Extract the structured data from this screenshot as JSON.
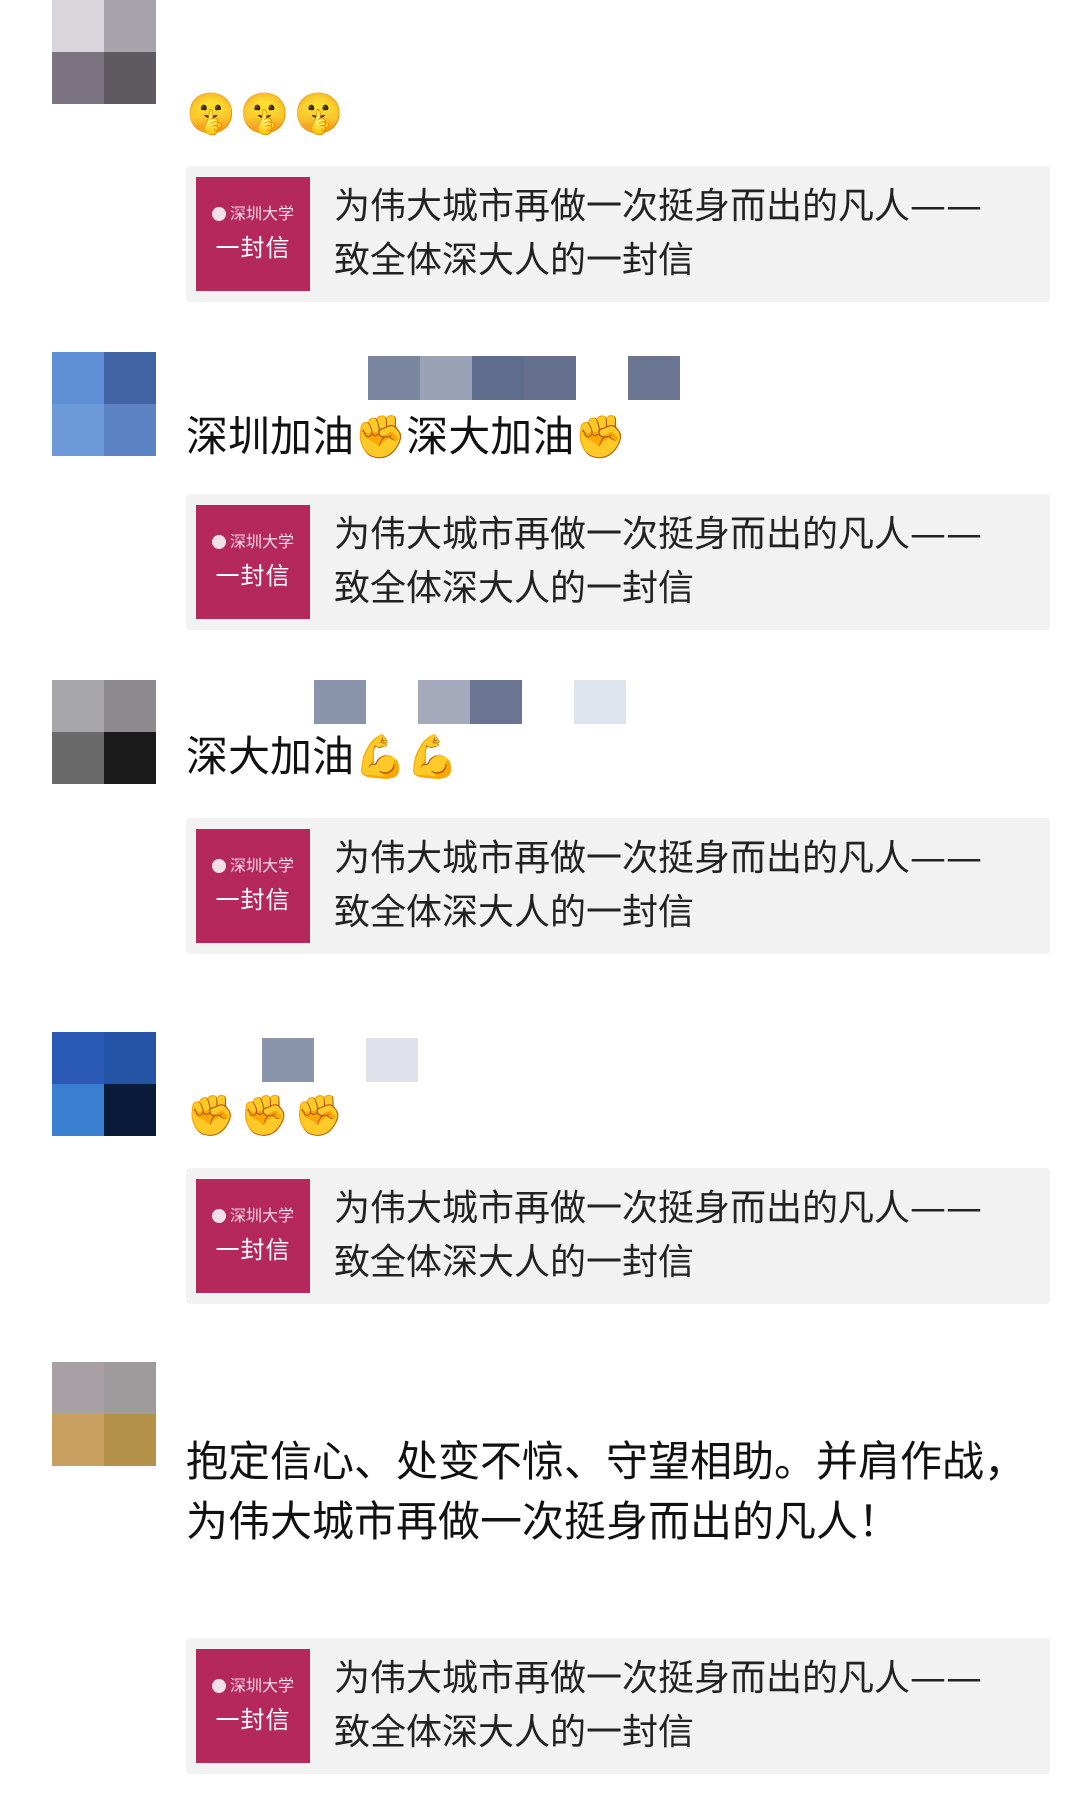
{
  "posts": [
    {
      "content": "",
      "emojis": [
        "🤫",
        "🤫",
        "🤫"
      ],
      "card": {
        "logo": "深圳大学",
        "thumb_title": "一封信",
        "line1": "为伟大城市再做一次挺身而出的凡人——",
        "line2": "致全体深大人的一封信"
      }
    },
    {
      "content": "深圳加油✊深大加油✊",
      "emojis": [],
      "card": {
        "logo": "深圳大学",
        "thumb_title": "一封信",
        "line1": "为伟大城市再做一次挺身而出的凡人——",
        "line2": "致全体深大人的一封信"
      }
    },
    {
      "content": "深大加油💪💪",
      "emojis": [],
      "card": {
        "logo": "深圳大学",
        "thumb_title": "一封信",
        "line1": "为伟大城市再做一次挺身而出的凡人——",
        "line2": "致全体深大人的一封信"
      }
    },
    {
      "content": "",
      "emojis": [
        "✊",
        "✊",
        "✊"
      ],
      "card": {
        "logo": "深圳大学",
        "thumb_title": "一封信",
        "line1": "为伟大城市再做一次挺身而出的凡人——",
        "line2": "致全体深大人的一封信"
      }
    },
    {
      "content": "抱定信心、处变不惊、守望相助。并肩作战，为伟大城市再做一次挺身而出的凡人！",
      "emojis": [],
      "card": {
        "logo": "深圳大学",
        "thumb_title": "一封信",
        "line1": "为伟大城市再做一次挺身而出的凡人——",
        "line2": "致全体深大人的一封信"
      }
    }
  ],
  "colors": {
    "card_bg": "#f2f2f2",
    "thumb_bg": "#b4285c",
    "avatar_1": [
      "#d8d6da",
      "#a7a3ab",
      "#7d7482",
      "#5e5a60"
    ],
    "avatar_2": [
      "#5e8ed4",
      "#3f63a3",
      "#6c9ad8",
      "#5b83c4"
    ],
    "avatar_3": [
      "#a7a6a8",
      "#8c8a8f",
      "#6a6a6a",
      "#1a1a1a"
    ],
    "avatar_4": [
      "#2a5ab6",
      "#2554a6",
      "#3a7ed0",
      "#0a1b3a"
    ],
    "avatar_5": [
      "#a8a0a4",
      "#9f9a9b",
      "#c99f5f",
      "#b59249"
    ]
  }
}
